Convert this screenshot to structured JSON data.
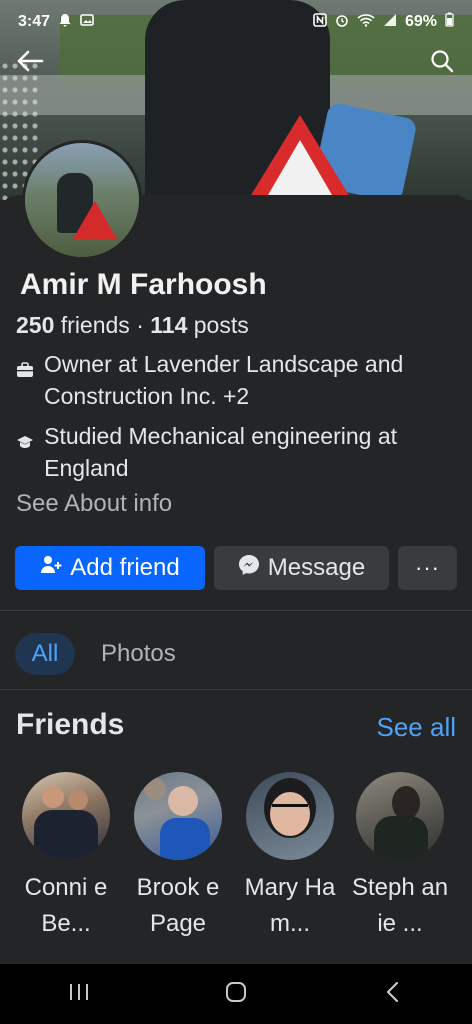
{
  "status_bar": {
    "time": "3:47",
    "battery": "69%"
  },
  "profile": {
    "name": "Amir M Farhoosh",
    "friends_count": "250",
    "friends_label": "friends",
    "separator": "·",
    "posts_count": "114",
    "posts_label": "posts",
    "work": "Owner at Lavender Landscape and Construction Inc. +2",
    "education": "Studied Mechanical engineering at England",
    "see_about": "See About info"
  },
  "actions": {
    "add_friend": "Add friend",
    "message": "Message",
    "more": "···"
  },
  "tabs": [
    {
      "label": "All",
      "active": true
    },
    {
      "label": "Photos",
      "active": false
    }
  ],
  "friends_section": {
    "title": "Friends",
    "see_all": "See all",
    "items": [
      {
        "name": "Conni e Be..."
      },
      {
        "name": "Brook e Page"
      },
      {
        "name": "Mary Ham..."
      },
      {
        "name": "Steph anie ..."
      }
    ]
  },
  "colors": {
    "accent": "#0866ff",
    "link": "#4fa3f7",
    "background": "#242526"
  }
}
